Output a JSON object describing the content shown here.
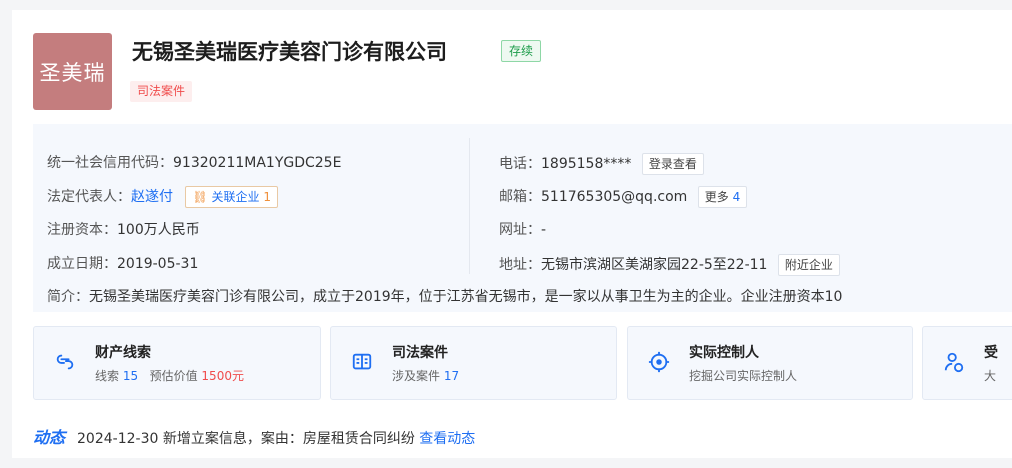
{
  "company": {
    "logo_text": "圣美瑞",
    "name": "无锡圣美瑞医疗美容门诊有限公司",
    "status": "存续",
    "tag": "司法案件"
  },
  "info": {
    "credit_code_label": "统一社会信用代码：",
    "credit_code": "91320211MA1YGDC25E",
    "legal_rep_label": "法定代表人：",
    "legal_rep": "赵遂付",
    "related_label": "关联企业",
    "related_count": "1",
    "capital_label": "注册资本：",
    "capital": "100万人民币",
    "founded_label": "成立日期：",
    "founded": "2019-05-31",
    "phone_label": "电话：",
    "phone": "1895158****",
    "phone_btn": "登录查看",
    "email_label": "邮箱：",
    "email": "511765305@qq.com",
    "email_more": "更多",
    "email_more_count": "4",
    "website_label": "网址：",
    "website": "-",
    "address_label": "地址：",
    "address": "无锡市滨湖区美湖家园22-5至22-11",
    "address_btn": "附近企业",
    "intro_label": "简介：",
    "intro": "无锡圣美瑞医疗美容门诊有限公司，成立于2019年，位于江苏省无锡市，是一家以从事卫生为主的企业。企业注册资本10"
  },
  "blocks": [
    {
      "title": "财产线索",
      "sub_a": "线索",
      "sub_a_num": "15",
      "sub_b": "预估价值",
      "sub_b_num": "1500元",
      "icon": "link-chain-icon"
    },
    {
      "title": "司法案件",
      "sub_a": "涉及案件",
      "sub_a_num": "17",
      "icon": "law-book-icon"
    },
    {
      "title": "实际控制人",
      "sub_a": "挖掘公司实际控制人",
      "icon": "target-icon"
    },
    {
      "title": "受",
      "sub_a": "大",
      "icon": "user-badge-icon"
    }
  ],
  "dynamic": {
    "label": "动态",
    "text": "2024-12-30 新增立案信息，案由：房屋租赁合同纠纷",
    "link": "查看动态"
  },
  "colors": {
    "accent": "#1f6ff2",
    "logo_bg": "#c47d7e",
    "status_green": "#1c9c4a",
    "tag_red": "#f04c4c"
  }
}
